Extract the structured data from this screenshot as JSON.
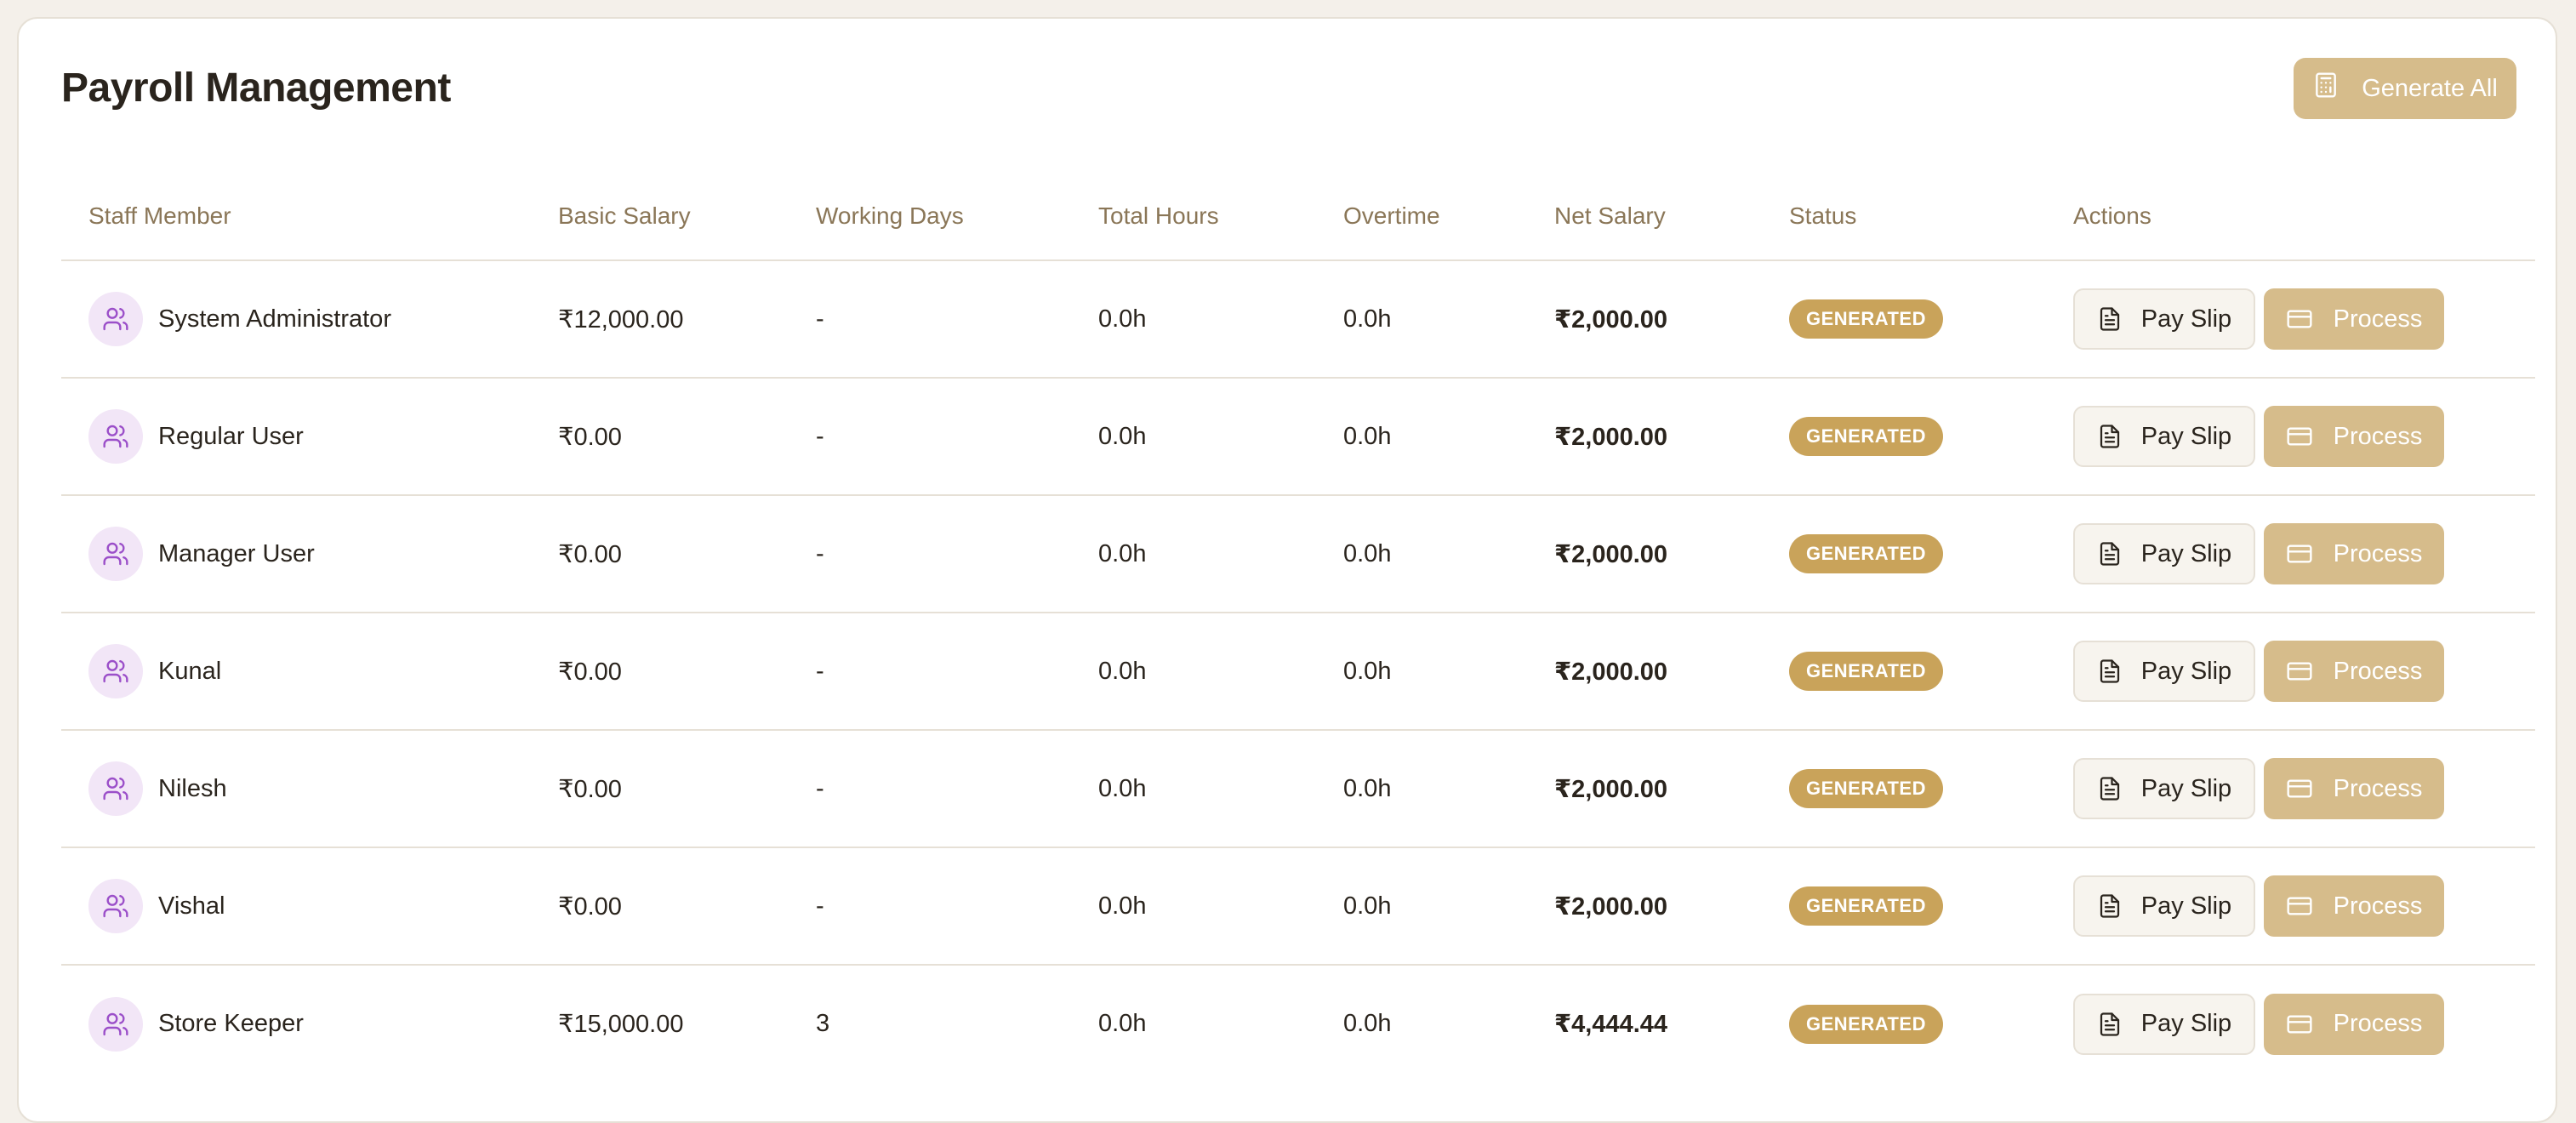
{
  "page": {
    "title": "Payroll Management",
    "generate_all_label": "Generate All"
  },
  "table": {
    "columns": [
      "Staff Member",
      "Basic Salary",
      "Working Days",
      "Total Hours",
      "Overtime",
      "Net Salary",
      "Status",
      "Actions"
    ],
    "rows": [
      {
        "name": "System Administrator",
        "basic_salary": "₹12,000.00",
        "working_days": "-",
        "total_hours": "0.0h",
        "overtime": "0.0h",
        "net_salary": "₹2,000.00",
        "status": "GENERATED"
      },
      {
        "name": "Regular User",
        "basic_salary": "₹0.00",
        "working_days": "-",
        "total_hours": "0.0h",
        "overtime": "0.0h",
        "net_salary": "₹2,000.00",
        "status": "GENERATED"
      },
      {
        "name": "Manager User",
        "basic_salary": "₹0.00",
        "working_days": "-",
        "total_hours": "0.0h",
        "overtime": "0.0h",
        "net_salary": "₹2,000.00",
        "status": "GENERATED"
      },
      {
        "name": "Kunal",
        "basic_salary": "₹0.00",
        "working_days": "-",
        "total_hours": "0.0h",
        "overtime": "0.0h",
        "net_salary": "₹2,000.00",
        "status": "GENERATED"
      },
      {
        "name": "Nilesh",
        "basic_salary": "₹0.00",
        "working_days": "-",
        "total_hours": "0.0h",
        "overtime": "0.0h",
        "net_salary": "₹2,000.00",
        "status": "GENERATED"
      },
      {
        "name": "Vishal",
        "basic_salary": "₹0.00",
        "working_days": "-",
        "total_hours": "0.0h",
        "overtime": "0.0h",
        "net_salary": "₹2,000.00",
        "status": "GENERATED"
      },
      {
        "name": "Store Keeper",
        "basic_salary": "₹15,000.00",
        "working_days": "3",
        "total_hours": "0.0h",
        "overtime": "0.0h",
        "net_salary": "₹4,444.44",
        "status": "GENERATED"
      }
    ],
    "actions": {
      "payslip_label": "Pay Slip",
      "process_label": "Process"
    }
  },
  "icons": {
    "generate_all": "calculator-icon",
    "avatar": "users-icon",
    "payslip": "file-text-icon",
    "process": "credit-card-icon"
  },
  "colors": {
    "background": "#f4f0ea",
    "accent": "#d6bc8b",
    "status_badge": "#c9a35a",
    "avatar_bg": "#f2e6f7",
    "avatar_icon": "#9b4fc9",
    "header_text": "#8a7657"
  }
}
